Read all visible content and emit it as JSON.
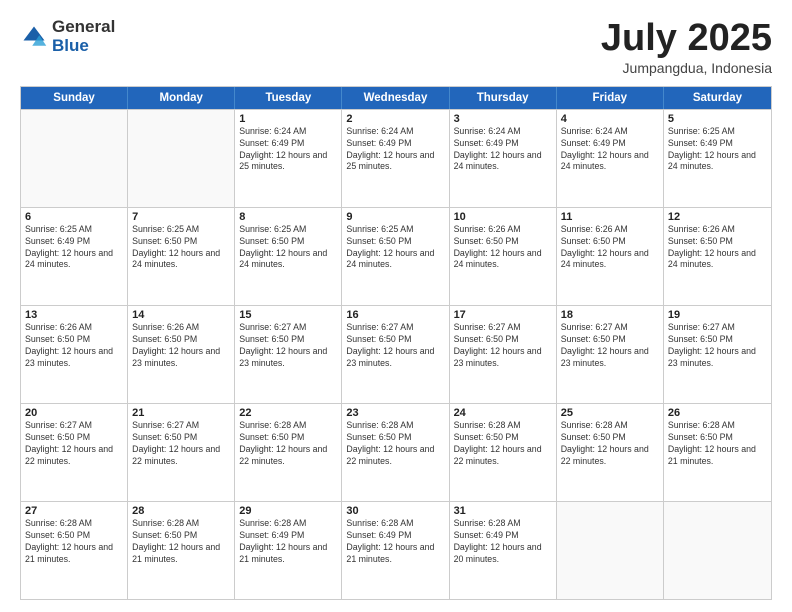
{
  "logo": {
    "general": "General",
    "blue": "Blue"
  },
  "title": "July 2025",
  "subtitle": "Jumpangdua, Indonesia",
  "days": [
    "Sunday",
    "Monday",
    "Tuesday",
    "Wednesday",
    "Thursday",
    "Friday",
    "Saturday"
  ],
  "weeks": [
    [
      {
        "day": "",
        "info": ""
      },
      {
        "day": "",
        "info": ""
      },
      {
        "day": "1",
        "info": "Sunrise: 6:24 AM\nSunset: 6:49 PM\nDaylight: 12 hours and 25 minutes."
      },
      {
        "day": "2",
        "info": "Sunrise: 6:24 AM\nSunset: 6:49 PM\nDaylight: 12 hours and 25 minutes."
      },
      {
        "day": "3",
        "info": "Sunrise: 6:24 AM\nSunset: 6:49 PM\nDaylight: 12 hours and 24 minutes."
      },
      {
        "day": "4",
        "info": "Sunrise: 6:24 AM\nSunset: 6:49 PM\nDaylight: 12 hours and 24 minutes."
      },
      {
        "day": "5",
        "info": "Sunrise: 6:25 AM\nSunset: 6:49 PM\nDaylight: 12 hours and 24 minutes."
      }
    ],
    [
      {
        "day": "6",
        "info": "Sunrise: 6:25 AM\nSunset: 6:49 PM\nDaylight: 12 hours and 24 minutes."
      },
      {
        "day": "7",
        "info": "Sunrise: 6:25 AM\nSunset: 6:50 PM\nDaylight: 12 hours and 24 minutes."
      },
      {
        "day": "8",
        "info": "Sunrise: 6:25 AM\nSunset: 6:50 PM\nDaylight: 12 hours and 24 minutes."
      },
      {
        "day": "9",
        "info": "Sunrise: 6:25 AM\nSunset: 6:50 PM\nDaylight: 12 hours and 24 minutes."
      },
      {
        "day": "10",
        "info": "Sunrise: 6:26 AM\nSunset: 6:50 PM\nDaylight: 12 hours and 24 minutes."
      },
      {
        "day": "11",
        "info": "Sunrise: 6:26 AM\nSunset: 6:50 PM\nDaylight: 12 hours and 24 minutes."
      },
      {
        "day": "12",
        "info": "Sunrise: 6:26 AM\nSunset: 6:50 PM\nDaylight: 12 hours and 24 minutes."
      }
    ],
    [
      {
        "day": "13",
        "info": "Sunrise: 6:26 AM\nSunset: 6:50 PM\nDaylight: 12 hours and 23 minutes."
      },
      {
        "day": "14",
        "info": "Sunrise: 6:26 AM\nSunset: 6:50 PM\nDaylight: 12 hours and 23 minutes."
      },
      {
        "day": "15",
        "info": "Sunrise: 6:27 AM\nSunset: 6:50 PM\nDaylight: 12 hours and 23 minutes."
      },
      {
        "day": "16",
        "info": "Sunrise: 6:27 AM\nSunset: 6:50 PM\nDaylight: 12 hours and 23 minutes."
      },
      {
        "day": "17",
        "info": "Sunrise: 6:27 AM\nSunset: 6:50 PM\nDaylight: 12 hours and 23 minutes."
      },
      {
        "day": "18",
        "info": "Sunrise: 6:27 AM\nSunset: 6:50 PM\nDaylight: 12 hours and 23 minutes."
      },
      {
        "day": "19",
        "info": "Sunrise: 6:27 AM\nSunset: 6:50 PM\nDaylight: 12 hours and 23 minutes."
      }
    ],
    [
      {
        "day": "20",
        "info": "Sunrise: 6:27 AM\nSunset: 6:50 PM\nDaylight: 12 hours and 22 minutes."
      },
      {
        "day": "21",
        "info": "Sunrise: 6:27 AM\nSunset: 6:50 PM\nDaylight: 12 hours and 22 minutes."
      },
      {
        "day": "22",
        "info": "Sunrise: 6:28 AM\nSunset: 6:50 PM\nDaylight: 12 hours and 22 minutes."
      },
      {
        "day": "23",
        "info": "Sunrise: 6:28 AM\nSunset: 6:50 PM\nDaylight: 12 hours and 22 minutes."
      },
      {
        "day": "24",
        "info": "Sunrise: 6:28 AM\nSunset: 6:50 PM\nDaylight: 12 hours and 22 minutes."
      },
      {
        "day": "25",
        "info": "Sunrise: 6:28 AM\nSunset: 6:50 PM\nDaylight: 12 hours and 22 minutes."
      },
      {
        "day": "26",
        "info": "Sunrise: 6:28 AM\nSunset: 6:50 PM\nDaylight: 12 hours and 21 minutes."
      }
    ],
    [
      {
        "day": "27",
        "info": "Sunrise: 6:28 AM\nSunset: 6:50 PM\nDaylight: 12 hours and 21 minutes."
      },
      {
        "day": "28",
        "info": "Sunrise: 6:28 AM\nSunset: 6:50 PM\nDaylight: 12 hours and 21 minutes."
      },
      {
        "day": "29",
        "info": "Sunrise: 6:28 AM\nSunset: 6:49 PM\nDaylight: 12 hours and 21 minutes."
      },
      {
        "day": "30",
        "info": "Sunrise: 6:28 AM\nSunset: 6:49 PM\nDaylight: 12 hours and 21 minutes."
      },
      {
        "day": "31",
        "info": "Sunrise: 6:28 AM\nSunset: 6:49 PM\nDaylight: 12 hours and 20 minutes."
      },
      {
        "day": "",
        "info": ""
      },
      {
        "day": "",
        "info": ""
      }
    ]
  ]
}
